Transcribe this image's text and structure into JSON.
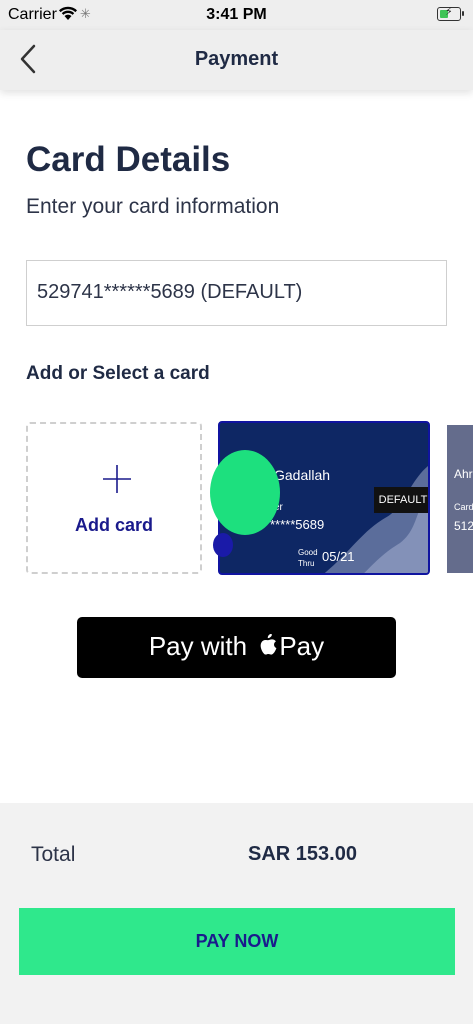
{
  "status_bar": {
    "carrier": "Carrier",
    "time": "3:41 PM"
  },
  "nav": {
    "title": "Payment",
    "back_icon": "chevron-left-icon"
  },
  "content": {
    "title": "Card Details",
    "subtitle": "Enter your card information",
    "selected_card": "529741******5689 (DEFAULT)",
    "cards_section_label": "Add or Select a card",
    "add_card_label": "Add card",
    "cards": [
      {
        "name": "Gadallah",
        "holder_label": "er",
        "number": "*****5689",
        "good_thru": [
          "Good",
          "Thru"
        ],
        "expiry": "05/21",
        "badge": "DEFAULT"
      },
      {
        "name": "Ahr",
        "holder_label": "Card",
        "number": "512"
      }
    ],
    "apple_pay_label_prefix": "Pay with",
    "apple_pay_label_suffix": "Pay"
  },
  "footer": {
    "total_label": "Total",
    "total_value": "SAR 153.00",
    "pay_now_label": "PAY NOW"
  },
  "colors": {
    "accent_green": "#2fe88c",
    "navy_text": "#1f2a44",
    "brand_blue": "#1a1a8c",
    "card_navy": "#0e2764"
  }
}
